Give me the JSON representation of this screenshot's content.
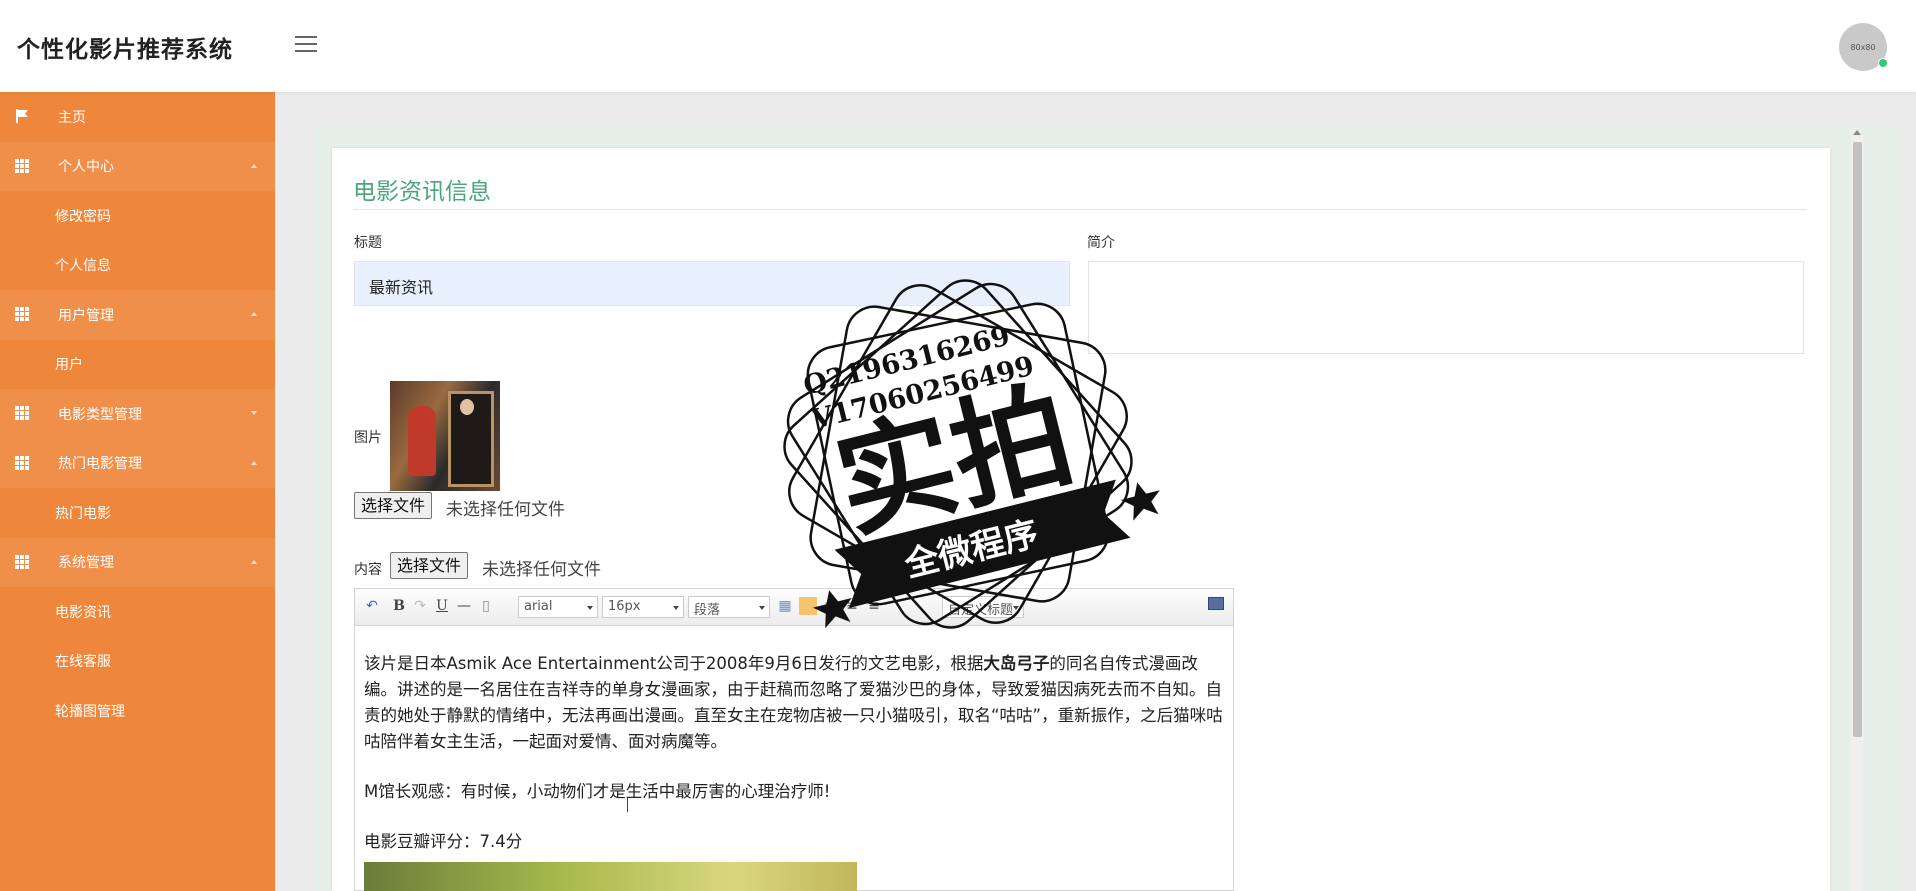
{
  "header": {
    "app_title": "个性化影片推荐系统",
    "avatar_label": "80x80"
  },
  "sidebar": {
    "items": [
      {
        "label": "主页",
        "icon": "flag-icon",
        "type": "top"
      },
      {
        "label": "个人中心",
        "icon": "grid-icon",
        "type": "group",
        "caret": "up"
      },
      {
        "label": "修改密码",
        "type": "sub"
      },
      {
        "label": "个人信息",
        "type": "sub"
      },
      {
        "label": "用户管理",
        "icon": "grid-icon",
        "type": "group",
        "caret": "up"
      },
      {
        "label": "用户",
        "type": "sub"
      },
      {
        "label": "电影类型管理",
        "icon": "grid-icon",
        "type": "group",
        "caret": "down"
      },
      {
        "label": "热门电影管理",
        "icon": "grid-icon",
        "type": "group",
        "caret": "up"
      },
      {
        "label": "热门电影",
        "type": "sub"
      },
      {
        "label": "系统管理",
        "icon": "grid-icon",
        "type": "group",
        "caret": "up"
      },
      {
        "label": "电影资讯",
        "type": "sub"
      },
      {
        "label": "在线客服",
        "type": "sub"
      },
      {
        "label": "轮播图管理",
        "type": "sub"
      }
    ]
  },
  "form": {
    "title": "电影资讯信息",
    "title_label": "标题",
    "title_value": "最新资讯",
    "summary_label": "简介",
    "summary_value": "",
    "image_label": "图片",
    "file_button": "选择文件",
    "file_none": "未选择任何文件",
    "content_label": "内容"
  },
  "editor": {
    "font_family": "arial",
    "font_size": "16px",
    "paragraph": "段落",
    "custom_heading": "自定义标题",
    "para1_before": "该片是日本Asmik Ace Entertainment公司于2008年9月6日发行的文艺电影，根据",
    "para1_bold": "大岛弓子",
    "para1_after": "的同名自传式漫画改编。讲述的是一名居住在吉祥寺的单身女漫画家，由于赶稿而忽略了爱猫沙巴的身体，导致爱猫因病死去而不自知。自责的她处于静默的情绪中，无法再画出漫画。直至女主在宠物店被一只小猫吸引，取名“咕咕”，重新振作，之后猫咪咕咕陪伴着女主生活，一起面对爱情、面对病魔等。",
    "para2": "M馆长观感：有时候，小动物们才是生活中最厉害的心理治疗师!",
    "para3": "电影豆瓣评分：7.4分"
  },
  "watermark": {
    "line1": "Q2196316269",
    "line2": "V17060256499",
    "big": "实拍",
    "banner": "全微程序"
  },
  "colors": {
    "sidebar": "#ee863c",
    "accent": "#4aa57a"
  }
}
